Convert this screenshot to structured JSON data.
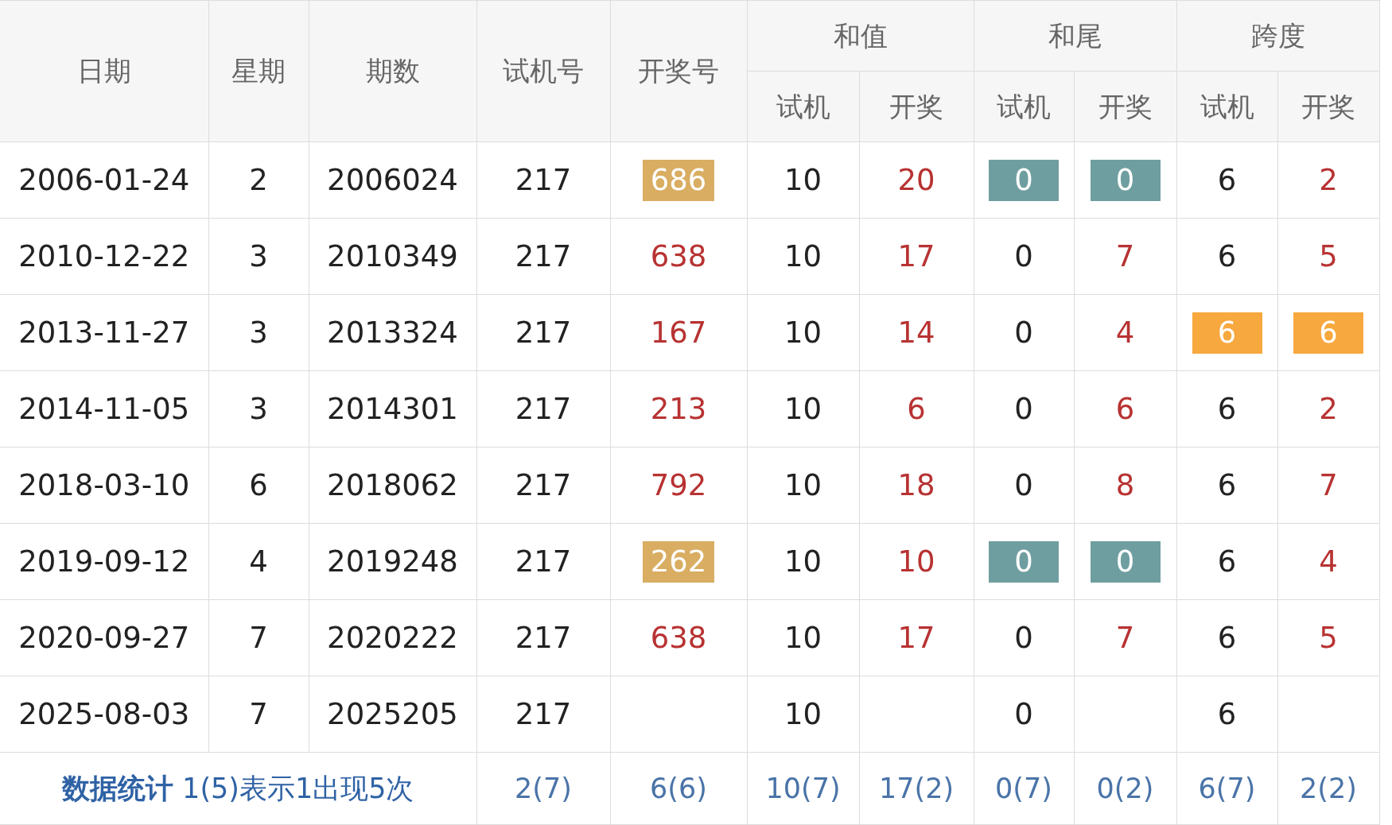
{
  "header": {
    "top": [
      {
        "label": "日期"
      },
      {
        "label": "星期"
      },
      {
        "label": "期数"
      },
      {
        "label": "试机号"
      },
      {
        "label": "开奖号"
      }
    ],
    "groups": [
      {
        "label": "和值",
        "columns": [
          {
            "label": "试机",
            "kind": "trial"
          },
          {
            "label": "开奖",
            "kind": "draw"
          }
        ]
      },
      {
        "label": "和尾",
        "columns": [
          {
            "label": "试机",
            "kind": "trial"
          },
          {
            "label": "开奖",
            "kind": "draw"
          }
        ]
      },
      {
        "label": "跨度",
        "columns": [
          {
            "label": "试机",
            "kind": "trial"
          },
          {
            "label": "开奖",
            "kind": "draw"
          }
        ]
      }
    ]
  },
  "rows": [
    {
      "cells": [
        {
          "text": "2006-01-24"
        },
        {
          "text": "2"
        },
        {
          "text": "2006024"
        },
        {
          "text": "217"
        },
        {
          "text": "686",
          "color": "#d9ad62"
        },
        {
          "text": "10"
        },
        {
          "text": "20"
        },
        {
          "text": "0",
          "color": "#6f9ea0"
        },
        {
          "text": "0",
          "color": "#6f9ea0"
        },
        {
          "text": "6"
        },
        {
          "text": "2"
        }
      ]
    },
    {
      "cells": [
        {
          "text": "2010-12-22"
        },
        {
          "text": "3"
        },
        {
          "text": "2010349"
        },
        {
          "text": "217"
        },
        {
          "text": "638"
        },
        {
          "text": "10"
        },
        {
          "text": "17"
        },
        {
          "text": "0"
        },
        {
          "text": "7"
        },
        {
          "text": "6"
        },
        {
          "text": "5"
        }
      ]
    },
    {
      "cells": [
        {
          "text": "2013-11-27"
        },
        {
          "text": "3"
        },
        {
          "text": "2013324"
        },
        {
          "text": "217"
        },
        {
          "text": "167"
        },
        {
          "text": "10"
        },
        {
          "text": "14"
        },
        {
          "text": "0"
        },
        {
          "text": "4"
        },
        {
          "text": "6",
          "color": "#f7a83e"
        },
        {
          "text": "6",
          "color": "#f7a83e"
        }
      ]
    },
    {
      "cells": [
        {
          "text": "2014-11-05"
        },
        {
          "text": "3"
        },
        {
          "text": "2014301"
        },
        {
          "text": "217"
        },
        {
          "text": "213"
        },
        {
          "text": "10"
        },
        {
          "text": "6"
        },
        {
          "text": "0"
        },
        {
          "text": "6"
        },
        {
          "text": "6"
        },
        {
          "text": "2"
        }
      ]
    },
    {
      "cells": [
        {
          "text": "2018-03-10"
        },
        {
          "text": "6"
        },
        {
          "text": "2018062"
        },
        {
          "text": "217"
        },
        {
          "text": "792"
        },
        {
          "text": "10"
        },
        {
          "text": "18"
        },
        {
          "text": "0"
        },
        {
          "text": "8"
        },
        {
          "text": "6"
        },
        {
          "text": "7"
        }
      ]
    },
    {
      "cells": [
        {
          "text": "2019-09-12"
        },
        {
          "text": "4"
        },
        {
          "text": "2019248"
        },
        {
          "text": "217"
        },
        {
          "text": "262",
          "color": "#d9ad62"
        },
        {
          "text": "10"
        },
        {
          "text": "10"
        },
        {
          "text": "0",
          "color": "#6f9ea0"
        },
        {
          "text": "0",
          "color": "#6f9ea0"
        },
        {
          "text": "6"
        },
        {
          "text": "4"
        }
      ]
    },
    {
      "cells": [
        {
          "text": "2020-09-27"
        },
        {
          "text": "7"
        },
        {
          "text": "2020222"
        },
        {
          "text": "217"
        },
        {
          "text": "638"
        },
        {
          "text": "10"
        },
        {
          "text": "17"
        },
        {
          "text": "0"
        },
        {
          "text": "7"
        },
        {
          "text": "6"
        },
        {
          "text": "5"
        }
      ]
    },
    {
      "cells": [
        {
          "text": "2025-08-03"
        },
        {
          "text": "7"
        },
        {
          "text": "2025205"
        },
        {
          "text": "217"
        },
        {
          "text": ""
        },
        {
          "text": "10"
        },
        {
          "text": ""
        },
        {
          "text": "0"
        },
        {
          "text": ""
        },
        {
          "text": "6"
        },
        {
          "text": ""
        }
      ]
    }
  ],
  "footer": {
    "note": "**数据统计** 1(5)表示1出现5次",
    "stats": [
      "2(7)",
      "6(6)",
      "10(7)",
      "17(2)",
      "0(7)",
      "0(2)",
      "6(7)",
      "2(2)"
    ]
  }
}
